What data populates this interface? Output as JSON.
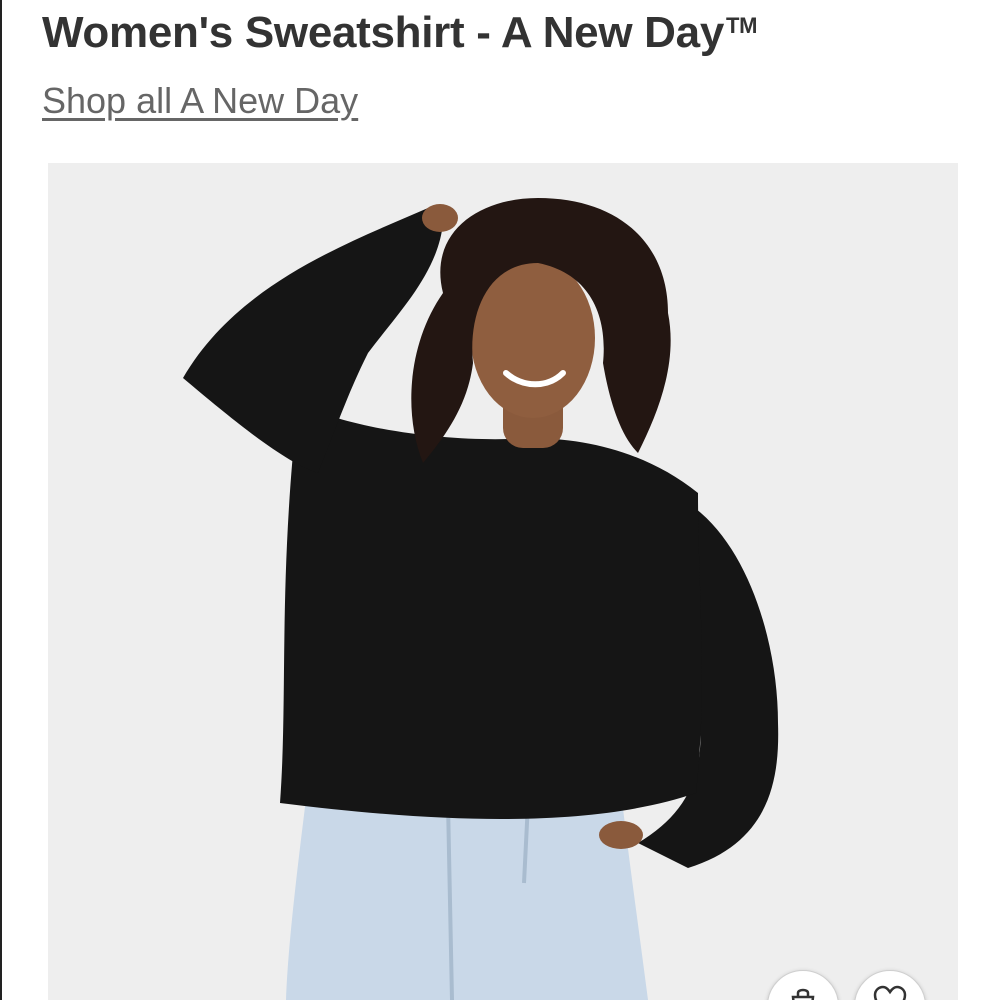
{
  "product": {
    "title": "Women's Sweatshirt - A New Day",
    "trademark": "TM",
    "brand_link": "Shop all A New Day"
  },
  "image": {
    "subject": "model in black crewneck sweatshirt and light wash jeans",
    "background_color": "#eeeeee",
    "sweatshirt_color": "#151515",
    "jeans_color": "#c9d8e8"
  },
  "actions": {
    "cart_icon": "shopping-bag-icon",
    "favorite_icon": "heart-icon"
  },
  "colors": {
    "title_text": "#333333",
    "link_text": "#666666"
  }
}
